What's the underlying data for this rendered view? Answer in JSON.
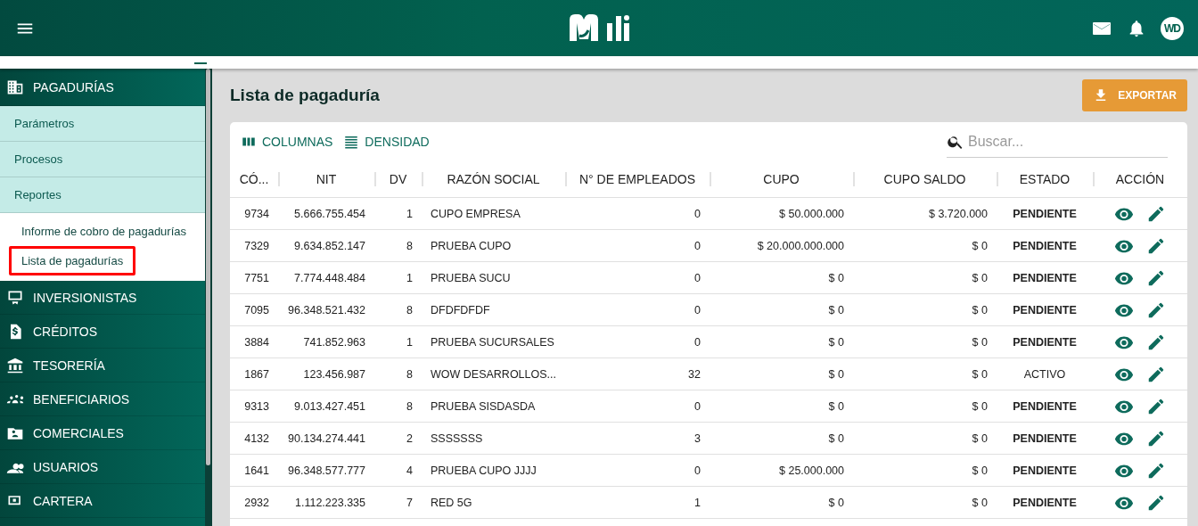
{
  "header": {
    "avatar": "WD"
  },
  "sidebar": {
    "items": [
      {
        "label": "PAGADURÍAS",
        "expanded": true,
        "children": [
          {
            "label": "Parámetros",
            "expanded": false
          },
          {
            "label": "Procesos",
            "expanded": false
          },
          {
            "label": "Reportes",
            "expanded": true,
            "children": [
              {
                "label": "Informe de cobro de pagadurías",
                "selected": false
              },
              {
                "label": "Lista de pagadurías",
                "selected": true
              }
            ]
          }
        ]
      },
      {
        "label": "INVERSIONISTAS",
        "expanded": false
      },
      {
        "label": "CRÉDITOS",
        "expanded": false
      },
      {
        "label": "TESORERÍA",
        "expanded": false
      },
      {
        "label": "BENEFICIARIOS",
        "expanded": false
      },
      {
        "label": "COMERCIALES",
        "expanded": false
      },
      {
        "label": "USUARIOS",
        "expanded": false
      },
      {
        "label": "CARTERA",
        "expanded": false
      }
    ]
  },
  "page": {
    "title": "Lista de pagaduría",
    "export_button": "EXPORTAR"
  },
  "toolbar": {
    "columns_button": "COLUMNAS",
    "density_button": "DENSIDAD",
    "search": {
      "placeholder": "Buscar..."
    }
  },
  "table": {
    "columns": [
      "CÓ...",
      "NIT",
      "DV",
      "RAZÓN SOCIAL",
      "N° DE EMPLEADOS",
      "CUPO",
      "CUPO SALDO",
      "ESTADO",
      "ACCIÓN"
    ],
    "rows": [
      {
        "codigo": "9734",
        "nit": "5.666.755.454",
        "dv": "1",
        "razon": "CUPO EMPRESA",
        "empleados": "0",
        "cupo": "$ 50.000.000",
        "saldo": "$ 3.720.000",
        "estado": "PENDIENTE",
        "emphasized": true
      },
      {
        "codigo": "7329",
        "nit": "9.634.852.147",
        "dv": "8",
        "razon": "PRUEBA CUPO",
        "empleados": "0",
        "cupo": "$ 20.000.000.000",
        "saldo": "$ 0",
        "estado": "PENDIENTE",
        "emphasized": true
      },
      {
        "codigo": "7751",
        "nit": "7.774.448.484",
        "dv": "1",
        "razon": "PRUEBA SUCU",
        "empleados": "0",
        "cupo": "$ 0",
        "saldo": "$ 0",
        "estado": "PENDIENTE",
        "emphasized": true
      },
      {
        "codigo": "7095",
        "nit": "96.348.521.432",
        "dv": "8",
        "razon": "DFDFDFDF",
        "empleados": "0",
        "cupo": "$ 0",
        "saldo": "$ 0",
        "estado": "PENDIENTE",
        "emphasized": true
      },
      {
        "codigo": "3884",
        "nit": "741.852.963",
        "dv": "1",
        "razon": "PRUEBA SUCURSALES",
        "empleados": "0",
        "cupo": "$ 0",
        "saldo": "$ 0",
        "estado": "PENDIENTE",
        "emphasized": true
      },
      {
        "codigo": "1867",
        "nit": "123.456.987",
        "dv": "8",
        "razon": "WOW DESARROLLOS...",
        "empleados": "32",
        "cupo": "$ 0",
        "saldo": "$ 0",
        "estado": "ACTIVO",
        "emphasized": false
      },
      {
        "codigo": "9313",
        "nit": "9.013.427.451",
        "dv": "8",
        "razon": "PRUEBA SISDASDA",
        "empleados": "0",
        "cupo": "$ 0",
        "saldo": "$ 0",
        "estado": "PENDIENTE",
        "emphasized": true
      },
      {
        "codigo": "4132",
        "nit": "90.134.274.441",
        "dv": "2",
        "razon": "SSSSSSS",
        "empleados": "3",
        "cupo": "$ 0",
        "saldo": "$ 0",
        "estado": "PENDIENTE",
        "emphasized": true
      },
      {
        "codigo": "1641",
        "nit": "96.348.577.777",
        "dv": "4",
        "razon": "PRUEBA CUPO JJJJ",
        "empleados": "0",
        "cupo": "$ 25.000.000",
        "saldo": "$ 0",
        "estado": "PENDIENTE",
        "emphasized": true
      },
      {
        "codigo": "2932",
        "nit": "1.112.223.335",
        "dv": "7",
        "razon": "RED 5G",
        "empleados": "1",
        "cupo": "$ 0",
        "saldo": "$ 0",
        "estado": "PENDIENTE",
        "emphasized": true
      }
    ]
  }
}
